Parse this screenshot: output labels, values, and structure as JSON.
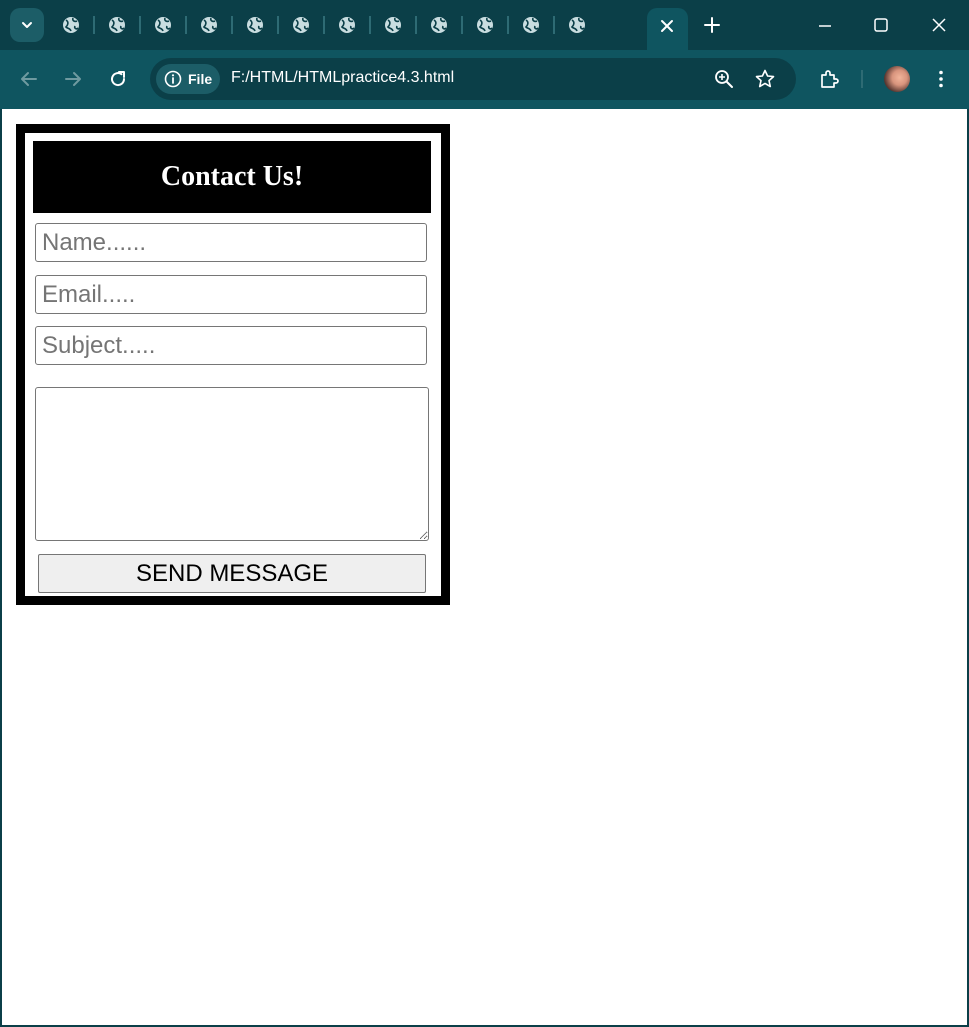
{
  "browser": {
    "tab_count": 13,
    "active_tab_close": "×",
    "url_chip_label": "File",
    "url": "F:/HTML/HTMLpractice4.3.html",
    "colors": {
      "frame": "#0b3f48",
      "toolbar": "#0f5560",
      "chip": "#1c5d67",
      "icon": "#c9dde0"
    },
    "icons": {
      "tab_search": "chevron-down-icon",
      "tab_favicon": "globe-icon",
      "new_tab": "plus-icon",
      "back": "arrow-left-icon",
      "forward": "arrow-right-icon",
      "reload": "reload-icon",
      "site_info": "info-icon",
      "zoom": "zoom-in-icon",
      "bookmark": "star-icon",
      "extensions": "puzzle-icon",
      "profile": "avatar",
      "menu": "kebab-menu-icon",
      "minimize": "minimize-icon",
      "maximize": "maximize-icon",
      "close": "close-icon"
    }
  },
  "page": {
    "background": "#ffffff",
    "form": {
      "title": "Contact Us!",
      "name_placeholder": "Name......",
      "email_placeholder": "Email.....",
      "subject_placeholder": "Subject.....",
      "message_value": "",
      "submit_label": "SEND MESSAGE",
      "border_color": "#000000",
      "header_bg": "#000000",
      "header_text_color": "#ffffff",
      "button_bg": "#efefef"
    }
  }
}
